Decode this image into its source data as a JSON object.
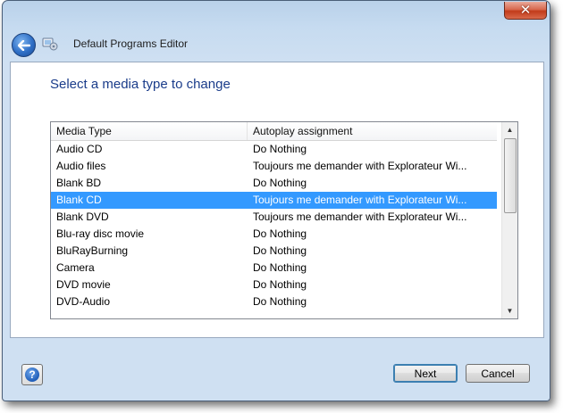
{
  "window": {
    "title": "Default Programs Editor",
    "close_glyph": "✕"
  },
  "page": {
    "heading": "Select a media type to change"
  },
  "list": {
    "columns": [
      "Media Type",
      "Autoplay assignment"
    ],
    "rows": [
      {
        "media": "Audio CD",
        "assignment": "Do Nothing",
        "selected": false
      },
      {
        "media": "Audio files",
        "assignment": "Toujours me demander with Explorateur Wi...",
        "selected": false
      },
      {
        "media": "Blank BD",
        "assignment": "Do Nothing",
        "selected": false
      },
      {
        "media": "Blank CD",
        "assignment": "Toujours me demander with Explorateur Wi...",
        "selected": true
      },
      {
        "media": "Blank DVD",
        "assignment": "Toujours me demander with Explorateur Wi...",
        "selected": false
      },
      {
        "media": "Blu-ray disc movie",
        "assignment": "Do Nothing",
        "selected": false
      },
      {
        "media": "BluRayBurning",
        "assignment": "Do Nothing",
        "selected": false
      },
      {
        "media": "Camera",
        "assignment": "Do Nothing",
        "selected": false
      },
      {
        "media": "DVD movie",
        "assignment": "Do Nothing",
        "selected": false
      },
      {
        "media": "DVD-Audio",
        "assignment": "Do Nothing",
        "selected": false
      }
    ]
  },
  "footer": {
    "help_glyph": "?",
    "next_label": "Next",
    "cancel_label": "Cancel"
  },
  "colors": {
    "heading": "#1a3c8a",
    "selection": "#3399ff",
    "frame": "#c6dbf0"
  },
  "icons": {
    "back": "back-arrow-icon",
    "program": "default-programs-icon",
    "help": "help-icon",
    "close": "close-icon"
  }
}
